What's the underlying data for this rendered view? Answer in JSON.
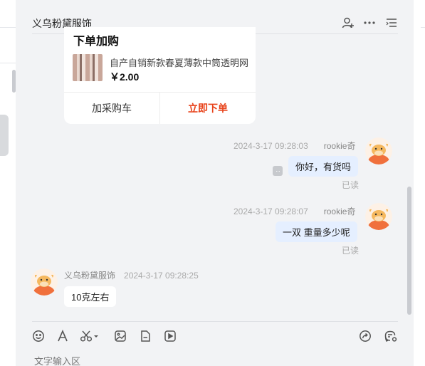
{
  "header": {
    "title": "义乌粉黛服饰",
    "icons": [
      "add-contact-icon",
      "more-icon",
      "menu-list-icon"
    ]
  },
  "product_card": {
    "title": "下单加购",
    "product_name": "自产自销新款春夏薄款中筒透明网",
    "price": "￥2.00",
    "add_to_cart_label": "加采购车",
    "buy_now_label": "立即下单",
    "buy_color": "#e8431b"
  },
  "messages": [
    {
      "time": "2024-3-17 09:28:03",
      "sender": "rookie奇",
      "text": "你好，有货吗",
      "status": "已读",
      "direction": "outgoing"
    },
    {
      "time": "2024-3-17 09:28:07",
      "sender": "rookie奇",
      "text": "一双 重量多少呢",
      "status": "已读",
      "direction": "outgoing"
    },
    {
      "time": "2024-3-17 09:28:25",
      "sender": "义乌粉黛服饰",
      "text": "10克左右",
      "direction": "incoming"
    }
  ],
  "toolbar": {
    "icons": [
      "emoji-icon",
      "font-icon",
      "scissors-icon",
      "image-icon",
      "file-icon",
      "video-icon"
    ],
    "right_icons": [
      "share-icon",
      "chat-settings-icon"
    ]
  },
  "input": {
    "placeholder": "文字输入区"
  },
  "colors": {
    "outgoing_bubble": "#e5efff",
    "incoming_bubble": "#ffffff",
    "background": "#f2f3f5"
  }
}
